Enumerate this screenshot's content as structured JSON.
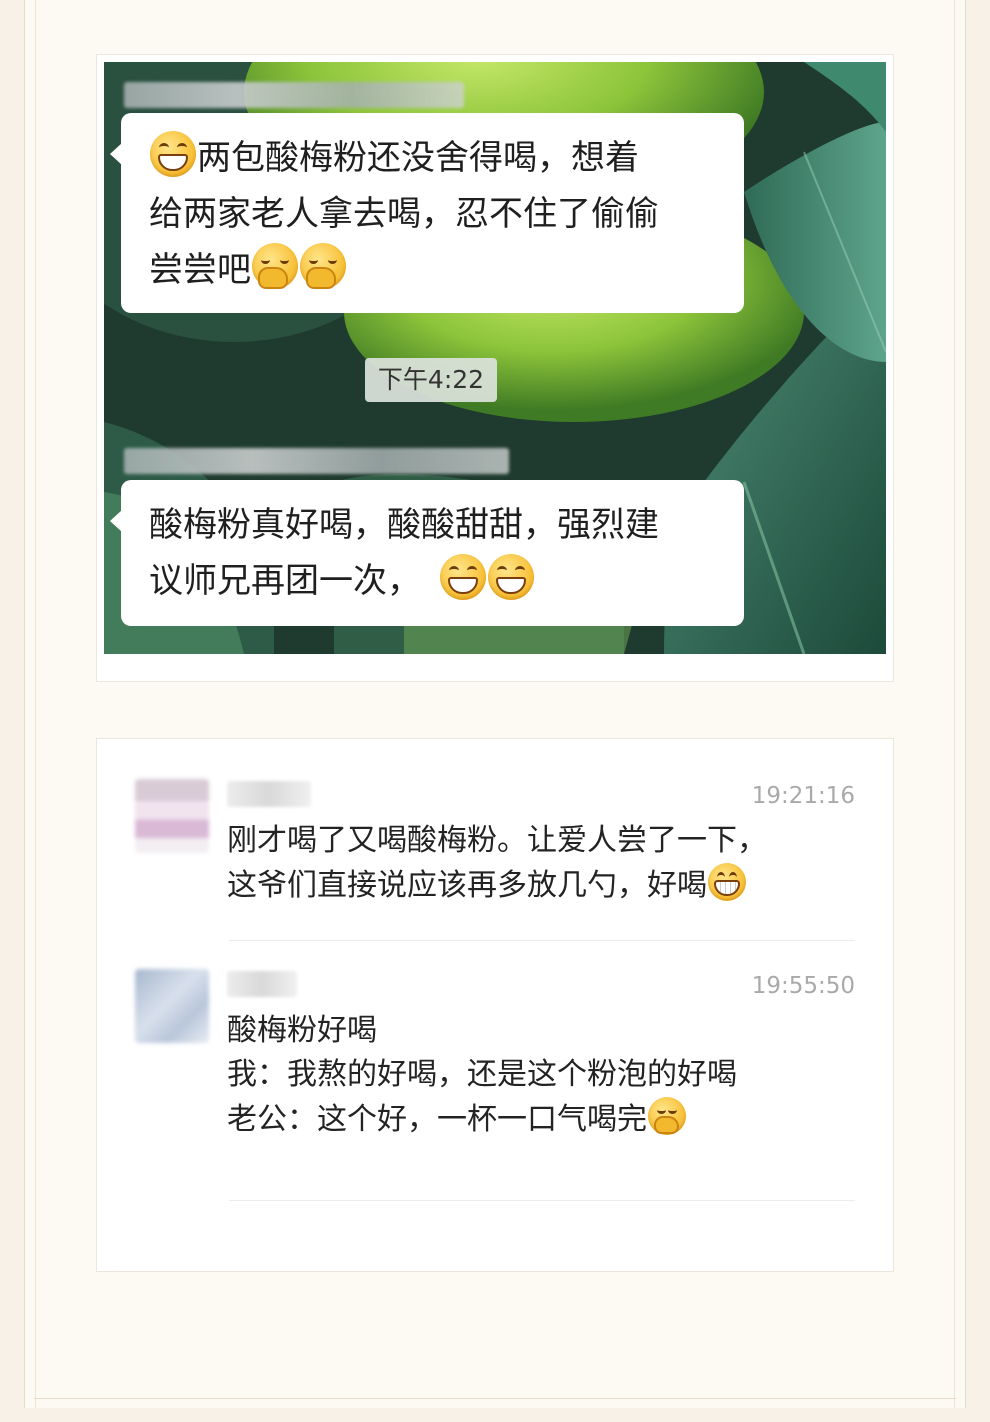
{
  "chat_screenshot": {
    "message_1": {
      "lines": [
        "两包酸梅粉还没舍得喝，想着",
        "给两家老人拿去喝，忍不住了偷偷",
        "尝尝吧"
      ],
      "leading_emoji": "grinning-face-emoji",
      "trailing_emojis": [
        "facepalm-emoji",
        "facepalm-emoji"
      ]
    },
    "time_chip": "下午4:22",
    "message_2": {
      "lines": [
        "酸梅粉真好喝，酸酸甜甜，强烈建",
        "议师兄再团一次，"
      ],
      "trailing_emojis": [
        "grinning-face-emoji",
        "grinning-face-emoji"
      ]
    }
  },
  "comments": [
    {
      "timestamp": "19:21:16",
      "lines": [
        "刚才喝了又喝酸梅粉。让爱人尝了一下，",
        "这爷们直接说应该再多放几勺，好喝"
      ],
      "trailing_emoji": "big-grin-emoji"
    },
    {
      "timestamp": "19:55:50",
      "lines": [
        "酸梅粉好喝",
        "我：我熬的好喝，还是这个粉泡的好喝",
        "老公：这个好，一杯一口气喝完"
      ],
      "trailing_emoji": "facepalm-emoji"
    }
  ],
  "colors": {
    "page_background": "#fdfaf4",
    "bubble": "#ffffff",
    "timestamp_text": "#a9a9a9",
    "emoji_yellow": "#f8c23a"
  }
}
